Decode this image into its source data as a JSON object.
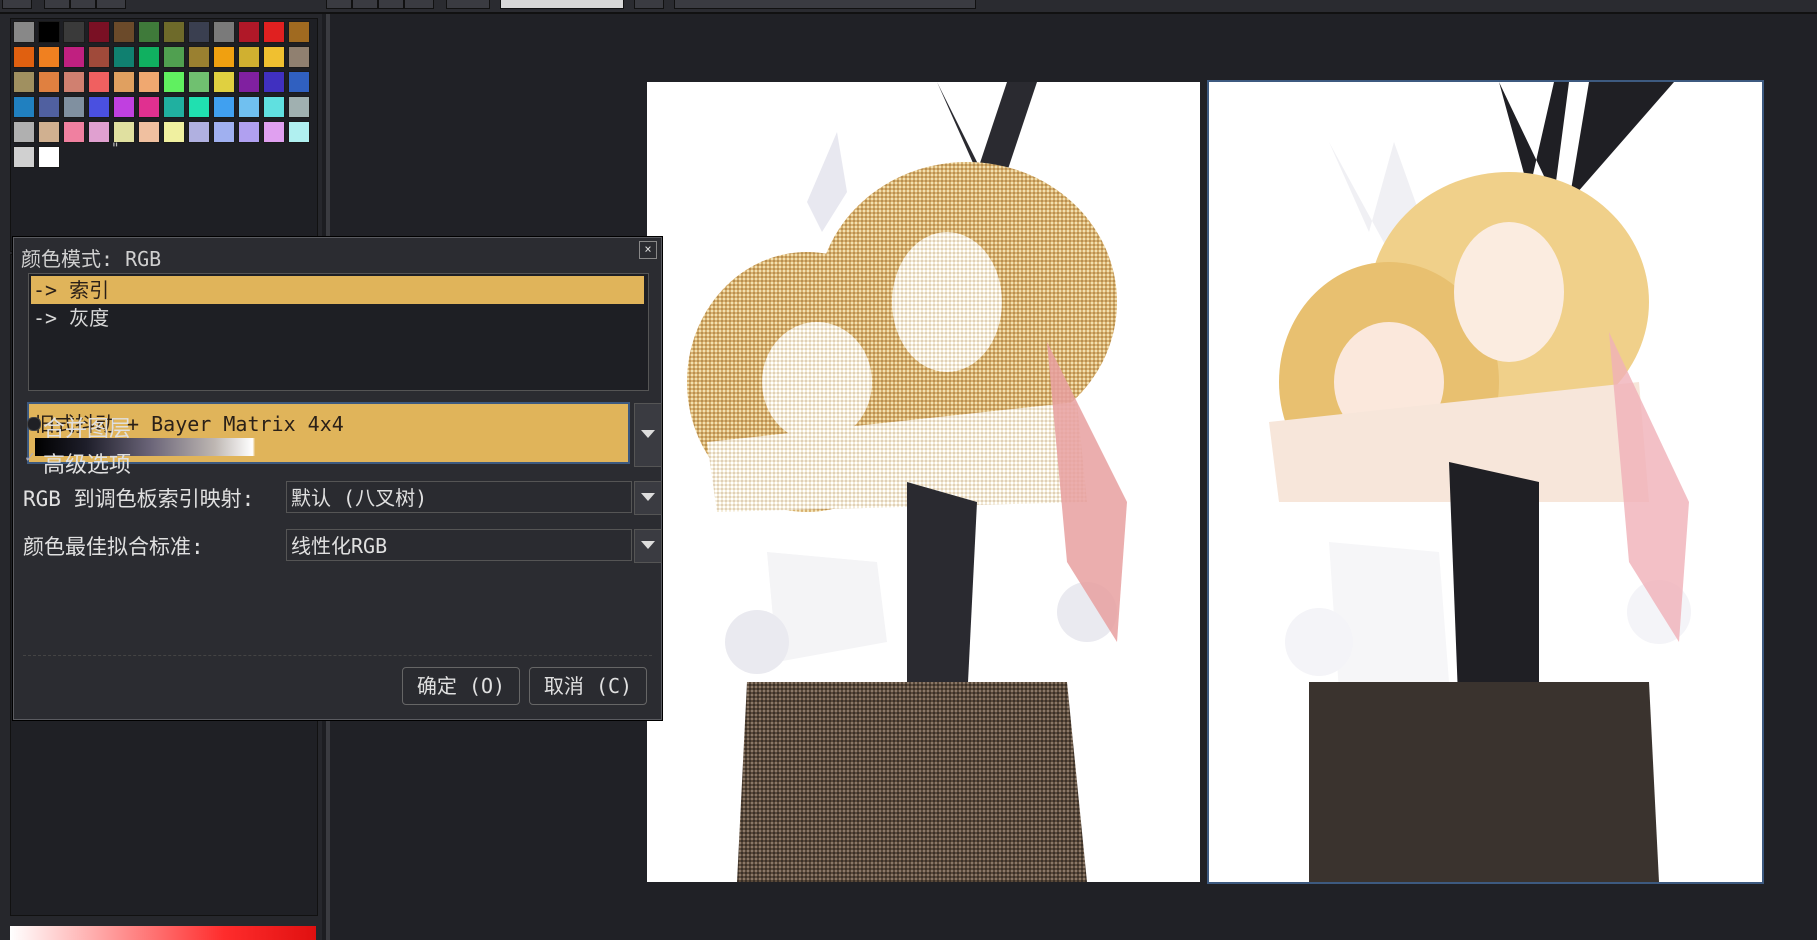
{
  "palette": {
    "colors": [
      "#888888",
      "#000000",
      "#3a3a3a",
      "#7a1024",
      "#6b4a2a",
      "#3f7a3a",
      "#6e6a2a",
      "#3a3f50",
      "#7a7a7a",
      "#b01828",
      "#e02020",
      "#a06a20",
      "#e06010",
      "#f08020",
      "#c02080",
      "#a04a3a",
      "#108070",
      "#10b060",
      "#50a050",
      "#9a8030",
      "#f0a010",
      "#d0b030",
      "#f0c030",
      "#908070",
      "#a09060",
      "#e08040",
      "#d08070",
      "#f06060",
      "#e0a060",
      "#f0a870",
      "#60f060",
      "#70c070",
      "#e0d040",
      "#8020a0",
      "#4030c0",
      "#3060c0",
      "#2080c0",
      "#5060a0",
      "#8090a0",
      "#4a50e0",
      "#c040e0",
      "#e03090",
      "#20b0a0",
      "#20e0b0",
      "#40a0f0",
      "#70c0f0",
      "#60e0e0",
      "#a0b0b0",
      "#b0b0b0",
      "#d0b090",
      "#f080a0",
      "#e0a0d0",
      "#e0e0a0",
      "#f0c0a0",
      "#f0f0a0",
      "#b0b0e0",
      "#a0b0f0",
      "#b0a0f0",
      "#e0a0f0",
      "#b0f0f0",
      "#d0d0d0",
      "#ffffff"
    ],
    "more_indicator": "\""
  },
  "dialog": {
    "title": "颜色模式: RGB",
    "close_label": "×",
    "modes": [
      "-> 索引",
      "-> 灰度"
    ],
    "selected_mode_index": 0,
    "dither": {
      "label": "旧式抖动 + Bayer Matrix 4x4"
    },
    "merge_layers": {
      "label": "合并图层",
      "checked": false
    },
    "advanced_options": {
      "label": "高级选项",
      "checked": true
    },
    "rgb_mapping": {
      "label": "RGB 到调色板索引映射:",
      "value": "默认 (八叉树)"
    },
    "best_fit": {
      "label": "颜色最佳拟合标准:",
      "value": "线性化RGB"
    },
    "ok_label": "确定 (O)",
    "cancel_label": "取消 (C)"
  },
  "colors": {
    "selection": "#e0b45a",
    "focus": "#3d5a80",
    "panel": "#26272c",
    "canvas": "#202126"
  }
}
